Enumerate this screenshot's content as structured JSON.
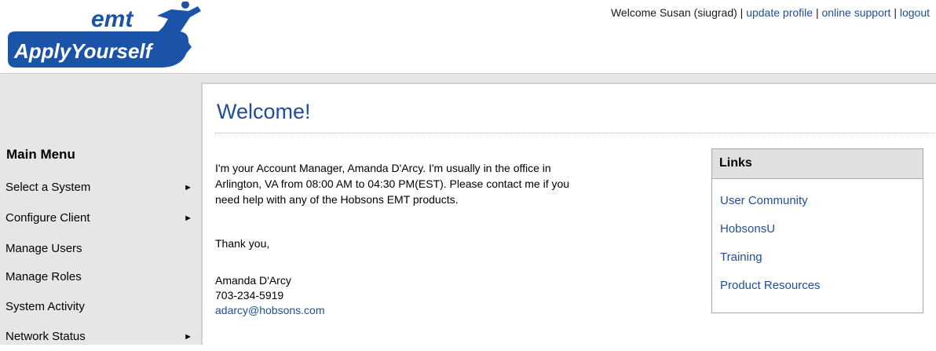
{
  "header": {
    "logo": {
      "top_text": "emt",
      "bottom_text": "ApplyYourself"
    },
    "welcome_text": "Welcome Susan (siugrad)",
    "separator": "|",
    "links": [
      "update profile",
      "online support",
      "logout"
    ]
  },
  "sidebar": {
    "title": "Main Menu",
    "items": [
      {
        "label": "Select a System",
        "arrow": "►"
      },
      {
        "label": "Configure Client",
        "arrow": "►"
      },
      {
        "label": "Manage Users"
      },
      {
        "label": "Manage Roles"
      },
      {
        "label": "System Activity"
      },
      {
        "label": "Network Status",
        "arrow": "►"
      }
    ]
  },
  "main": {
    "title": "Welcome!",
    "lines": [
      "I'm your Account Manager, Amanda D'Arcy. I'm usually in the office in",
      "Arlington, VA from 08:00 AM to 04:30 PM(EST). Please contact me if you",
      "need help with any of the Hobsons EMT products."
    ],
    "thanks": "Thank you,",
    "signature": {
      "name": "Amanda D'Arcy",
      "phone": "703-234-5919",
      "email": "adarcy@hobsons.com"
    }
  },
  "links_panel": {
    "title": "Links",
    "items": [
      "User Community",
      "HobsonsU",
      "Training",
      "Product Resources"
    ]
  },
  "colors": {
    "link": "#1f4e99",
    "logo_blue": "#1a53a8",
    "panel_gray": "#e6e6e6"
  }
}
